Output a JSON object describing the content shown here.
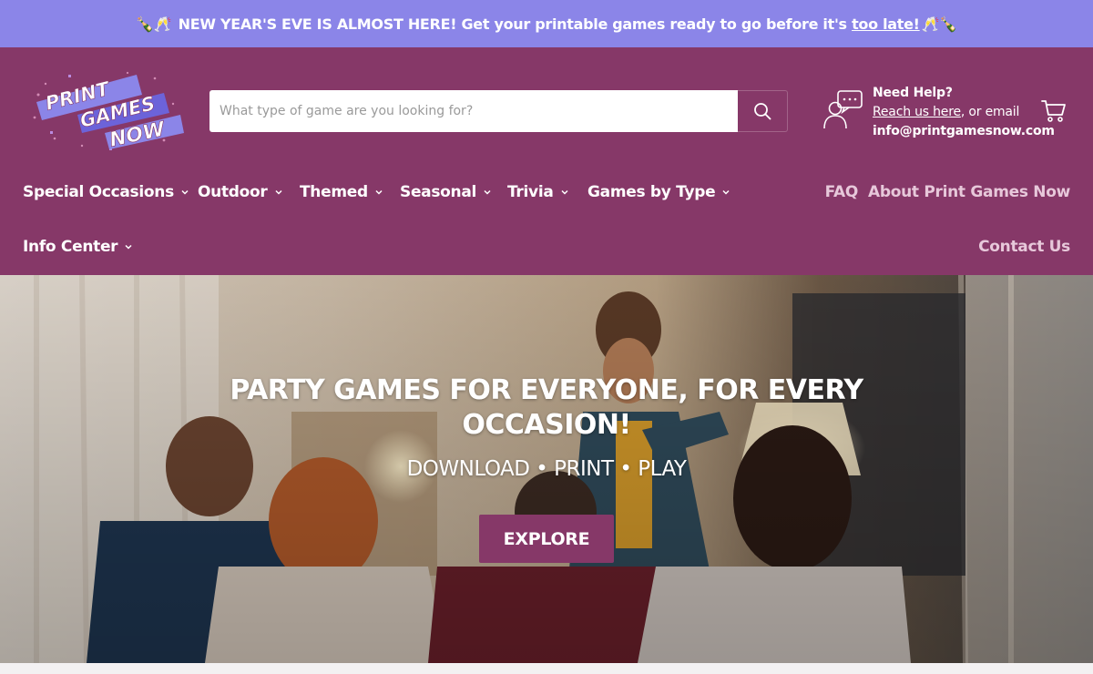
{
  "announcement": {
    "emoji_left": "🍾🥂",
    "text": "NEW YEAR'S EVE IS ALMOST HERE! Get your printable games ready to go before it's",
    "link": "too late!",
    "emoji_right": "🥂🍾"
  },
  "logo": {
    "alt": "PRINT GAMES NOW",
    "line1": "PRINT",
    "line2": "GAMES",
    "line3": "NOW"
  },
  "search": {
    "placeholder": "What type of game are you looking for?",
    "icon": "search-icon"
  },
  "help": {
    "title": "Need Help?",
    "link": "Reach us here",
    "suffix": ", or email",
    "email": "info@printgamesnow.com",
    "icon": "chat-support-icon"
  },
  "cart": {
    "icon": "cart-icon"
  },
  "nav": {
    "left": [
      {
        "label": "Special Occasions"
      },
      {
        "label": "Outdoor"
      },
      {
        "label": "Themed"
      },
      {
        "label": "Seasonal"
      },
      {
        "label": "Trivia"
      },
      {
        "label": "Games by Type"
      },
      {
        "label": "Info Center"
      }
    ],
    "right": [
      {
        "label": "FAQ"
      },
      {
        "label": "About Print Games Now"
      },
      {
        "label": "Contact Us"
      }
    ]
  },
  "hero": {
    "title": "PARTY GAMES FOR EVERYONE, FOR EVERY OCCASION!",
    "subtitle": "DOWNLOAD • PRINT • PLAY",
    "button": "EXPLORE"
  },
  "colors": {
    "announcement_bg": "#8b85e8",
    "header_bg": "#863868",
    "button_bg": "#863868",
    "nav_right_text": "#e7c8da"
  }
}
